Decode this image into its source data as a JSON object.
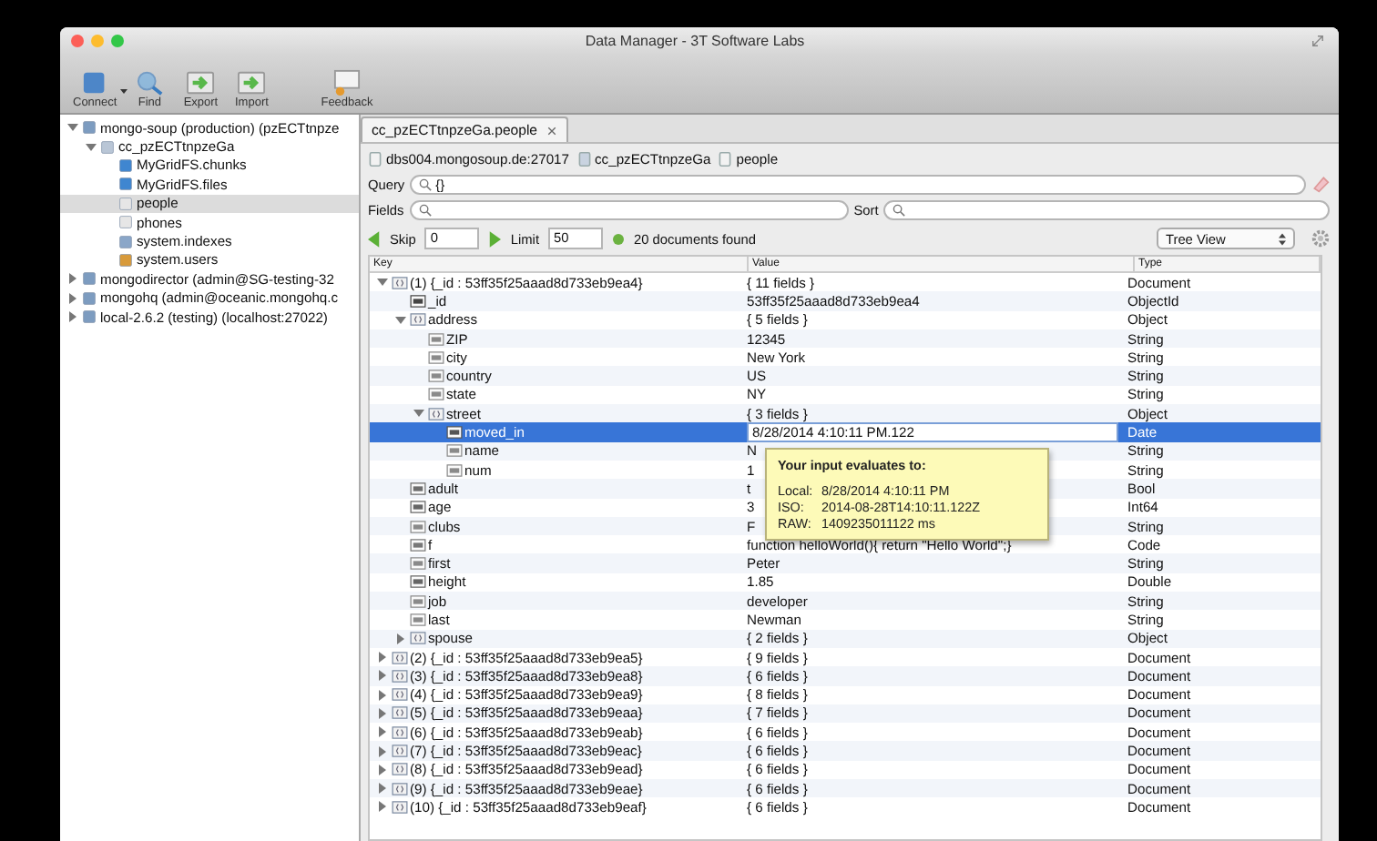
{
  "window": {
    "title": "Data Manager - 3T Software Labs"
  },
  "toolbar": [
    {
      "label": "Connect",
      "kind": "connect"
    },
    {
      "label": "Find",
      "kind": "find"
    },
    {
      "label": "Export",
      "kind": "export"
    },
    {
      "label": "Import",
      "kind": "import"
    },
    {
      "label": "Feedback",
      "kind": "feedback"
    }
  ],
  "sidebar": {
    "items": [
      {
        "label": "mongo-soup (production) (pzECTtnpze",
        "kind": "server",
        "selected": false,
        "expanded": true,
        "children": [
          {
            "label": "cc_pzECTtnpzeGa",
            "kind": "database",
            "selected": false,
            "expanded": true,
            "children": [
              {
                "label": "MyGridFS.chunks",
                "kind": "gridfs",
                "selected": false
              },
              {
                "label": "MyGridFS.files",
                "kind": "gridfs",
                "selected": false
              },
              {
                "label": "people",
                "kind": "collection",
                "selected": true
              },
              {
                "label": "phones",
                "kind": "collection",
                "selected": false
              },
              {
                "label": "system.indexes",
                "kind": "indexes",
                "selected": false
              },
              {
                "label": "system.users",
                "kind": "users",
                "selected": false
              }
            ]
          }
        ]
      },
      {
        "label": "mongodirector (admin@SG-testing-32",
        "kind": "server",
        "selected": false,
        "expanded": false
      },
      {
        "label": "mongohq (admin@oceanic.mongohq.c",
        "kind": "server",
        "selected": false,
        "expanded": false
      },
      {
        "label": "local-2.6.2 (testing) (localhost:27022)",
        "kind": "server",
        "selected": false,
        "expanded": false
      }
    ]
  },
  "tab": {
    "label": "cc_pzECTtnpzeGa.people"
  },
  "breadcrumb": [
    "dbs004.mongosoup.de:27017",
    "cc_pzECTtnpzeGa",
    "people"
  ],
  "query": {
    "label": "Query",
    "value": "{}"
  },
  "fields": {
    "label": "Fields"
  },
  "sort": {
    "label": "Sort"
  },
  "paging": {
    "skip_label": "Skip",
    "skip": "0",
    "limit_label": "Limit",
    "limit": "50",
    "found": "20 documents found",
    "view": "Tree View"
  },
  "tree": {
    "columns": [
      "Key",
      "Value",
      "Type"
    ],
    "rows": [
      {
        "key": "(1) {_id : 53ff35f25aaad8d733eb9ea4}",
        "value": "{ 11 fields }",
        "type": "Document",
        "kind": "object",
        "selected": false,
        "expanded": true,
        "children": [
          {
            "key": "_id",
            "value": "53ff35f25aaad8d733eb9ea4",
            "type": "ObjectId",
            "kind": "id",
            "selected": false
          },
          {
            "key": "address",
            "value": "{ 5 fields }",
            "type": "Object",
            "kind": "object",
            "selected": false,
            "expanded": true,
            "children": [
              {
                "key": "ZIP",
                "value": "12345",
                "type": "String",
                "kind": "string",
                "selected": false
              },
              {
                "key": "city",
                "value": "New York",
                "type": "String",
                "kind": "string",
                "selected": false
              },
              {
                "key": "country",
                "value": "US",
                "type": "String",
                "kind": "string",
                "selected": false
              },
              {
                "key": "state",
                "value": "NY",
                "type": "String",
                "kind": "string",
                "selected": false
              },
              {
                "key": "street",
                "value": "{ 3 fields }",
                "type": "Object",
                "kind": "object",
                "selected": false,
                "expanded": true,
                "children": [
                  {
                    "key": "moved_in",
                    "value": "8/28/2014 4:10:11 PM.122",
                    "type": "Date",
                    "kind": "date",
                    "selected": true
                  },
                  {
                    "key": "name",
                    "value": "N",
                    "type": "String",
                    "kind": "string",
                    "selected": false
                  },
                  {
                    "key": "num",
                    "value": "1",
                    "type": "String",
                    "kind": "string",
                    "selected": false
                  }
                ]
              }
            ]
          },
          {
            "key": "adult",
            "value": "t",
            "type": "Bool",
            "kind": "bool",
            "selected": false
          },
          {
            "key": "age",
            "value": "3",
            "type": "Int64",
            "kind": "number",
            "selected": false
          },
          {
            "key": "clubs",
            "value": "F",
            "type": "String",
            "kind": "string",
            "selected": false
          },
          {
            "key": "f",
            "value": "function helloWorld(){       return \"Hello World\";}",
            "type": "Code",
            "kind": "code",
            "selected": false
          },
          {
            "key": "first",
            "value": "Peter",
            "type": "String",
            "kind": "string",
            "selected": false
          },
          {
            "key": "height",
            "value": "1.85",
            "type": "Double",
            "kind": "number",
            "selected": false
          },
          {
            "key": "job",
            "value": "developer",
            "type": "String",
            "kind": "string",
            "selected": false
          },
          {
            "key": "last",
            "value": "Newman",
            "type": "String",
            "kind": "string",
            "selected": false
          },
          {
            "key": "spouse",
            "value": "{ 2 fields }",
            "type": "Object",
            "kind": "object",
            "selected": false,
            "expanded": false
          }
        ]
      },
      {
        "key": "(2) {_id : 53ff35f25aaad8d733eb9ea5}",
        "value": "{ 9 fields }",
        "type": "Document",
        "kind": "object",
        "selected": false,
        "expanded": false
      },
      {
        "key": "(3) {_id : 53ff35f25aaad8d733eb9ea8}",
        "value": "{ 6 fields }",
        "type": "Document",
        "kind": "object",
        "selected": false,
        "expanded": false
      },
      {
        "key": "(4) {_id : 53ff35f25aaad8d733eb9ea9}",
        "value": "{ 8 fields }",
        "type": "Document",
        "kind": "object",
        "selected": false,
        "expanded": false
      },
      {
        "key": "(5) {_id : 53ff35f25aaad8d733eb9eaa}",
        "value": "{ 7 fields }",
        "type": "Document",
        "kind": "object",
        "selected": false,
        "expanded": false
      },
      {
        "key": "(6) {_id : 53ff35f25aaad8d733eb9eab}",
        "value": "{ 6 fields }",
        "type": "Document",
        "kind": "object",
        "selected": false,
        "expanded": false
      },
      {
        "key": "(7) {_id : 53ff35f25aaad8d733eb9eac}",
        "value": "{ 6 fields }",
        "type": "Document",
        "kind": "object",
        "selected": false,
        "expanded": false
      },
      {
        "key": "(8) {_id : 53ff35f25aaad8d733eb9ead}",
        "value": "{ 6 fields }",
        "type": "Document",
        "kind": "object",
        "selected": false,
        "expanded": false
      },
      {
        "key": "(9) {_id : 53ff35f25aaad8d733eb9eae}",
        "value": "{ 6 fields }",
        "type": "Document",
        "kind": "object",
        "selected": false,
        "expanded": false
      },
      {
        "key": "(10) {_id : 53ff35f25aaad8d733eb9eaf}",
        "value": "{ 6 fields }",
        "type": "Document",
        "kind": "object",
        "selected": false,
        "expanded": false
      }
    ]
  },
  "tooltip": {
    "title": "Your input evaluates to:",
    "lines": [
      {
        "label": "Local:",
        "value": "8/28/2014 4:10:11 PM"
      },
      {
        "label": "ISO:",
        "value": "2014-08-28T14:10:11.122Z"
      },
      {
        "label": "RAW:",
        "value": "1409235011122 ms"
      }
    ]
  }
}
